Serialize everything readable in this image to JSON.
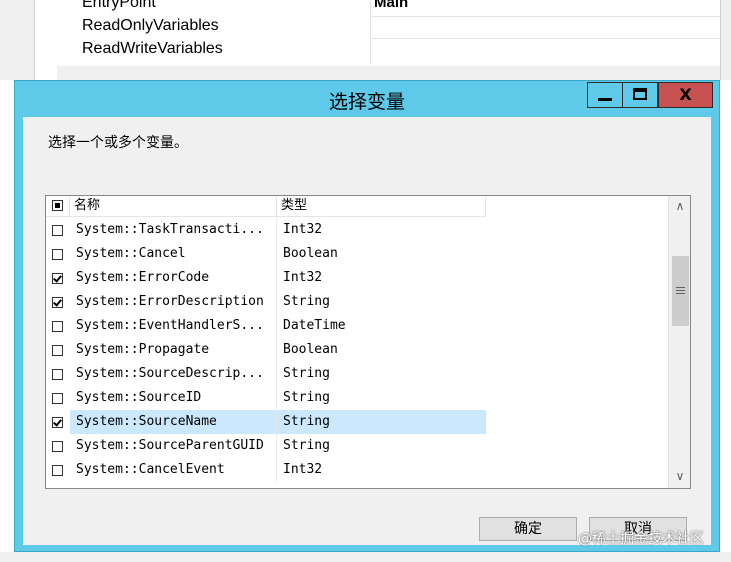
{
  "background": {
    "rows": [
      {
        "label": "EntryPoint",
        "value": "Main"
      },
      {
        "label": "ReadOnlyVariables",
        "value": ""
      },
      {
        "label": "ReadWriteVariables",
        "value": ""
      }
    ]
  },
  "dialog": {
    "title": "选择变量",
    "controls": {
      "minimize": "minimize",
      "maximize": "maximize",
      "close_glyph": "X"
    },
    "prompt": "选择一个或多个变量。",
    "columns": {
      "name": "名称",
      "type": "类型"
    },
    "rows": [
      {
        "name": "System::TaskTransacti...",
        "type": "Int32",
        "checked": false
      },
      {
        "name": "System::Cancel",
        "type": "Boolean",
        "checked": false
      },
      {
        "name": "System::ErrorCode",
        "type": "Int32",
        "checked": true
      },
      {
        "name": "System::ErrorDescription",
        "type": "String",
        "checked": true
      },
      {
        "name": "System::EventHandlerS...",
        "type": "DateTime",
        "checked": false
      },
      {
        "name": "System::Propagate",
        "type": "Boolean",
        "checked": false
      },
      {
        "name": "System::SourceDescrip...",
        "type": "String",
        "checked": false
      },
      {
        "name": "System::SourceID",
        "type": "String",
        "checked": false
      },
      {
        "name": "System::SourceName",
        "type": "String",
        "checked": true,
        "selected": true
      },
      {
        "name": "System::SourceParentGUID",
        "type": "String",
        "checked": false
      },
      {
        "name": "System::CancelEvent",
        "type": "Int32",
        "checked": false
      }
    ],
    "buttons": {
      "ok": "确定",
      "cancel": "取消"
    }
  },
  "watermark": "@稀土掘金技术社区",
  "colors": {
    "titlebar": "#5ec9e8",
    "close": "#c75050",
    "selection": "#cce8ff"
  }
}
